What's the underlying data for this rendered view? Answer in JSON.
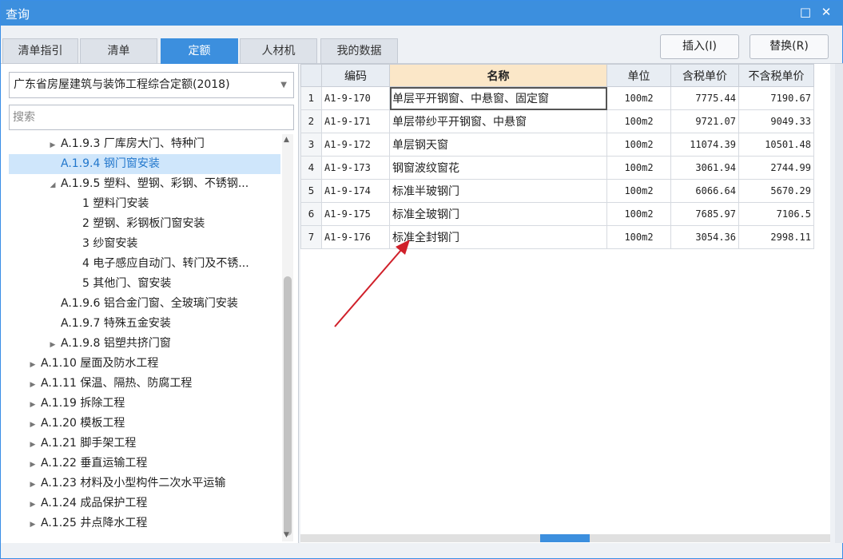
{
  "window": {
    "title": "查询",
    "maximize_icon": "□",
    "close_icon": "✕"
  },
  "tabs": [
    {
      "label": "清单指引"
    },
    {
      "label": "清单"
    },
    {
      "label": "定额"
    },
    {
      "label": "人材机"
    },
    {
      "label": "我的数据"
    }
  ],
  "active_tab": "定额",
  "buttons": {
    "insert": "插入(I)",
    "replace": "替换(R)"
  },
  "library": {
    "selected": "广东省房屋建筑与装饰工程综合定额(2018)"
  },
  "search": {
    "placeholder": "搜索",
    "value": ""
  },
  "tree": [
    {
      "label": "A.1.9.3 厂库房大门、特种门",
      "toggle": "▶"
    },
    {
      "label": "A.1.9.4 钢门窗安装",
      "toggle": ""
    },
    {
      "label": "A.1.9.5 塑料、塑钢、彩钢、不锈钢...",
      "toggle": "◢"
    },
    {
      "label": "1 塑料门安装",
      "toggle": ""
    },
    {
      "label": "2 塑钢、彩钢板门窗安装",
      "toggle": ""
    },
    {
      "label": "3 纱窗安装",
      "toggle": ""
    },
    {
      "label": "4 电子感应自动门、转门及不锈...",
      "toggle": ""
    },
    {
      "label": "5 其他门、窗安装",
      "toggle": ""
    },
    {
      "label": "A.1.9.6 铝合金门窗、全玻璃门安装",
      "toggle": ""
    },
    {
      "label": "A.1.9.7 特殊五金安装",
      "toggle": ""
    },
    {
      "label": "A.1.9.8 铝塑共挤门窗",
      "toggle": "▶"
    },
    {
      "label": "A.1.10 屋面及防水工程",
      "toggle": "▶"
    },
    {
      "label": "A.1.11 保温、隔热、防腐工程",
      "toggle": "▶"
    },
    {
      "label": "A.1.19 拆除工程",
      "toggle": "▶"
    },
    {
      "label": "A.1.20 模板工程",
      "toggle": "▶"
    },
    {
      "label": "A.1.21 脚手架工程",
      "toggle": "▶"
    },
    {
      "label": "A.1.22 垂直运输工程",
      "toggle": "▶"
    },
    {
      "label": "A.1.23 材料及小型构件二次水平运输",
      "toggle": "▶"
    },
    {
      "label": "A.1.24 成品保护工程",
      "toggle": "▶"
    },
    {
      "label": "A.1.25 井点降水工程",
      "toggle": "▶"
    }
  ],
  "selected_tree_item": "A.1.9.4 钢门窗安装",
  "table": {
    "headers": [
      "",
      "编码",
      "名称",
      "单位",
      "含税单价",
      "不含税单价"
    ],
    "rows": [
      [
        "1",
        "A1-9-170",
        "单层平开钢窗、中悬窗、固定窗",
        "100m2",
        "7775.44",
        "7190.67"
      ],
      [
        "2",
        "A1-9-171",
        "单层带纱平开钢窗、中悬窗",
        "100m2",
        "9721.07",
        "9049.33"
      ],
      [
        "3",
        "A1-9-172",
        "单层钢天窗",
        "100m2",
        "11074.39",
        "10501.48"
      ],
      [
        "4",
        "A1-9-173",
        "钢窗波纹窗花",
        "100m2",
        "3061.94",
        "2744.99"
      ],
      [
        "5",
        "A1-9-174",
        "标准半玻钢门",
        "100m2",
        "6066.64",
        "5670.29"
      ],
      [
        "6",
        "A1-9-175",
        "标准全玻钢门",
        "100m2",
        "7685.97",
        "7106.5"
      ],
      [
        "7",
        "A1-9-176",
        "标准全封钢门",
        "100m2",
        "3054.36",
        "2998.11"
      ]
    ]
  },
  "colors": {
    "accent": "#3c8fde",
    "header_highlight": "#fbe7c8",
    "annotation_arrow": "#d0202a"
  }
}
